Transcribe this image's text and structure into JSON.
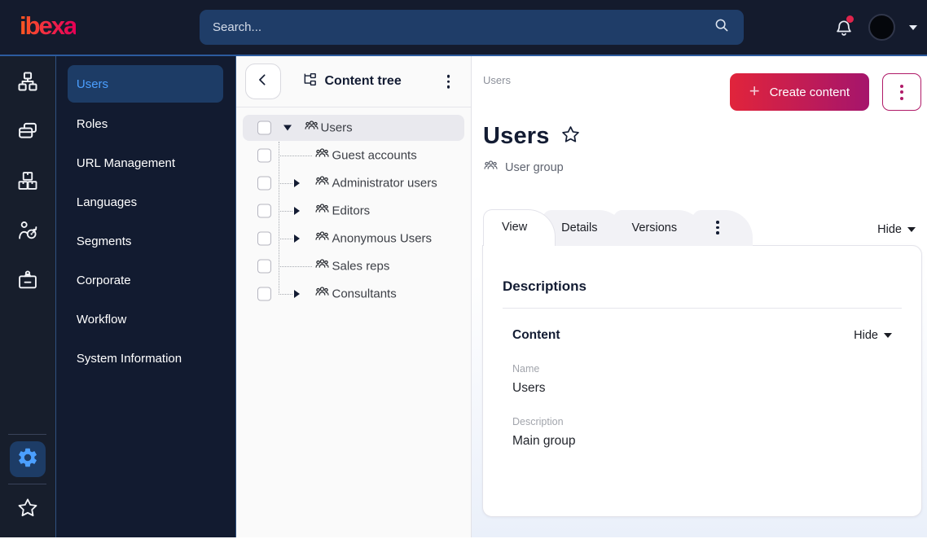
{
  "topbar": {
    "logo": "ibexa",
    "search_placeholder": "Search..."
  },
  "menu": {
    "items": [
      {
        "label": "Users",
        "active": true
      },
      {
        "label": "Roles"
      },
      {
        "label": "URL Management"
      },
      {
        "label": "Languages"
      },
      {
        "label": "Segments"
      },
      {
        "label": "Corporate"
      },
      {
        "label": "Workflow"
      },
      {
        "label": "System Information"
      }
    ]
  },
  "tree": {
    "title": "Content tree",
    "items": [
      {
        "label": "Users",
        "caret": "down",
        "selected": true
      },
      {
        "label": "Guest accounts",
        "caret": "none"
      },
      {
        "label": "Administrator users",
        "caret": "right"
      },
      {
        "label": "Editors",
        "caret": "right"
      },
      {
        "label": "Anonymous Users",
        "caret": "right"
      },
      {
        "label": "Sales reps",
        "caret": "none"
      },
      {
        "label": "Consultants",
        "caret": "right"
      }
    ]
  },
  "main": {
    "breadcrumb": "Users",
    "create_button_label": "Create content",
    "title": "Users",
    "content_type": "User group",
    "tabs": [
      {
        "label": "View",
        "active": true
      },
      {
        "label": "Details"
      },
      {
        "label": "Versions"
      }
    ],
    "hide_label": "Hide",
    "card": {
      "heading": "Descriptions",
      "section": {
        "title": "Content",
        "hide_label": "Hide",
        "fields": [
          {
            "label": "Name",
            "value": "Users"
          },
          {
            "label": "Description",
            "value": "Main group"
          }
        ]
      }
    }
  },
  "icons": {
    "rail": [
      "org-chart",
      "pages",
      "packages",
      "person-target",
      "id-badge"
    ],
    "rail_bottom": [
      "gear",
      "star"
    ],
    "topbar": [
      "search",
      "bell",
      "avatar",
      "caret-down"
    ],
    "status_colors": {
      "notification_dot": "#e0244c"
    }
  },
  "colors": {
    "topbar_bg": "#141b2d",
    "accent_line": "#2c5b9e",
    "active_blue": "#4b9fff",
    "active_item_bg": "#1d3c66",
    "brand_gradient_start": "#e1243b",
    "brand_gradient_end": "#a5156c",
    "magenta": "#b01a68"
  }
}
